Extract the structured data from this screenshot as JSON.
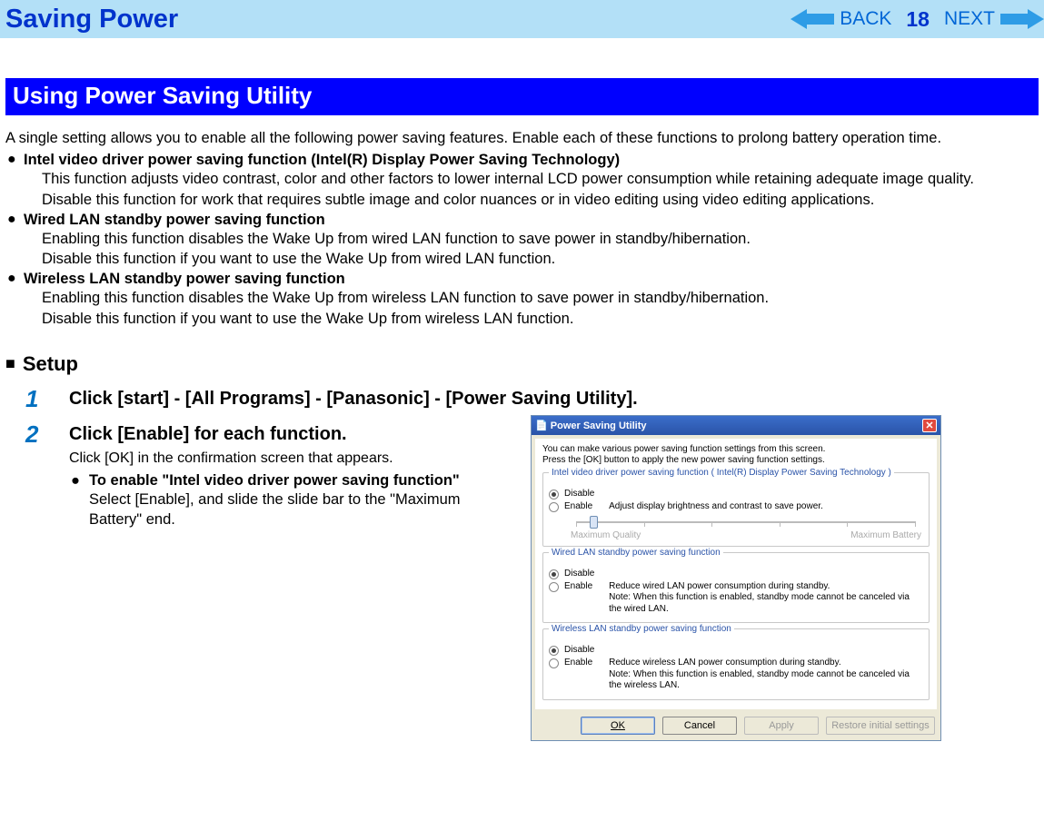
{
  "header": {
    "title": "Saving Power",
    "back": "BACK",
    "next": "NEXT",
    "page": "18"
  },
  "section": {
    "title": "Using Power Saving Utility",
    "intro": "A single setting allows you to enable all the following power saving features. Enable each of these functions to prolong battery operation time.",
    "b1_head": "Intel video driver power saving function (Intel(R) Display Power Saving Technology)",
    "b1_d1": "This function adjusts video contrast, color and other factors to lower internal LCD power consumption while retaining adequate image quality.",
    "b1_d2": "Disable this function for work that requires subtle image and color nuances or in video editing using video editing applications.",
    "b2_head": "Wired LAN standby power saving function",
    "b2_d1": "Enabling this function disables the Wake Up from wired LAN function to save power in standby/hibernation.",
    "b2_d2": "Disable this function if you want to use the Wake Up from wired LAN function.",
    "b3_head": "Wireless LAN standby power saving function",
    "b3_d1": "Enabling this function disables the Wake Up from wireless LAN function to save power in standby/hibernation.",
    "b3_d2": "Disable this function if you want to use the Wake Up from wireless LAN function."
  },
  "setup": {
    "heading": "Setup",
    "step1_num": "1",
    "step1_title": "Click [start] - [All Programs] - [Panasonic] - [Power Saving Utility].",
    "step2_num": "2",
    "step2_title": "Click [Enable] for each function.",
    "step2_sub": "Click [OK] in the confirmation screen that appears.",
    "step2_bh": "To enable \"Intel video driver power saving function\"",
    "step2_bd": "Select [Enable], and slide the slide bar to the \"Maximum Battery\" end."
  },
  "dialog": {
    "title": "Power Saving Utility",
    "intro1": "You can make various power saving function settings from this screen.",
    "intro2": "Press the [OK] button to apply the new power saving function settings.",
    "g1_title": "Intel video driver power saving function ( Intel(R) Display Power Saving Technology )",
    "disable": "Disable",
    "enable": "Enable",
    "g1_enable_desc": "Adjust display brightness and contrast to save power.",
    "slider_left": "Maximum Quality",
    "slider_right": "Maximum Battery",
    "g2_title": "Wired LAN standby power saving function",
    "g2_enable_d1": "Reduce wired LAN power consumption during standby.",
    "g2_enable_d2": "Note: When this function is enabled, standby mode cannot be canceled via the wired LAN.",
    "g3_title": "Wireless LAN standby power saving function",
    "g3_enable_d1": "Reduce wireless LAN power consumption during standby.",
    "g3_enable_d2": "Note: When this function is enabled, standby mode cannot be canceled via the wireless LAN.",
    "btn_ok": "OK",
    "btn_cancel": "Cancel",
    "btn_apply": "Apply",
    "btn_restore": "Restore initial settings"
  }
}
